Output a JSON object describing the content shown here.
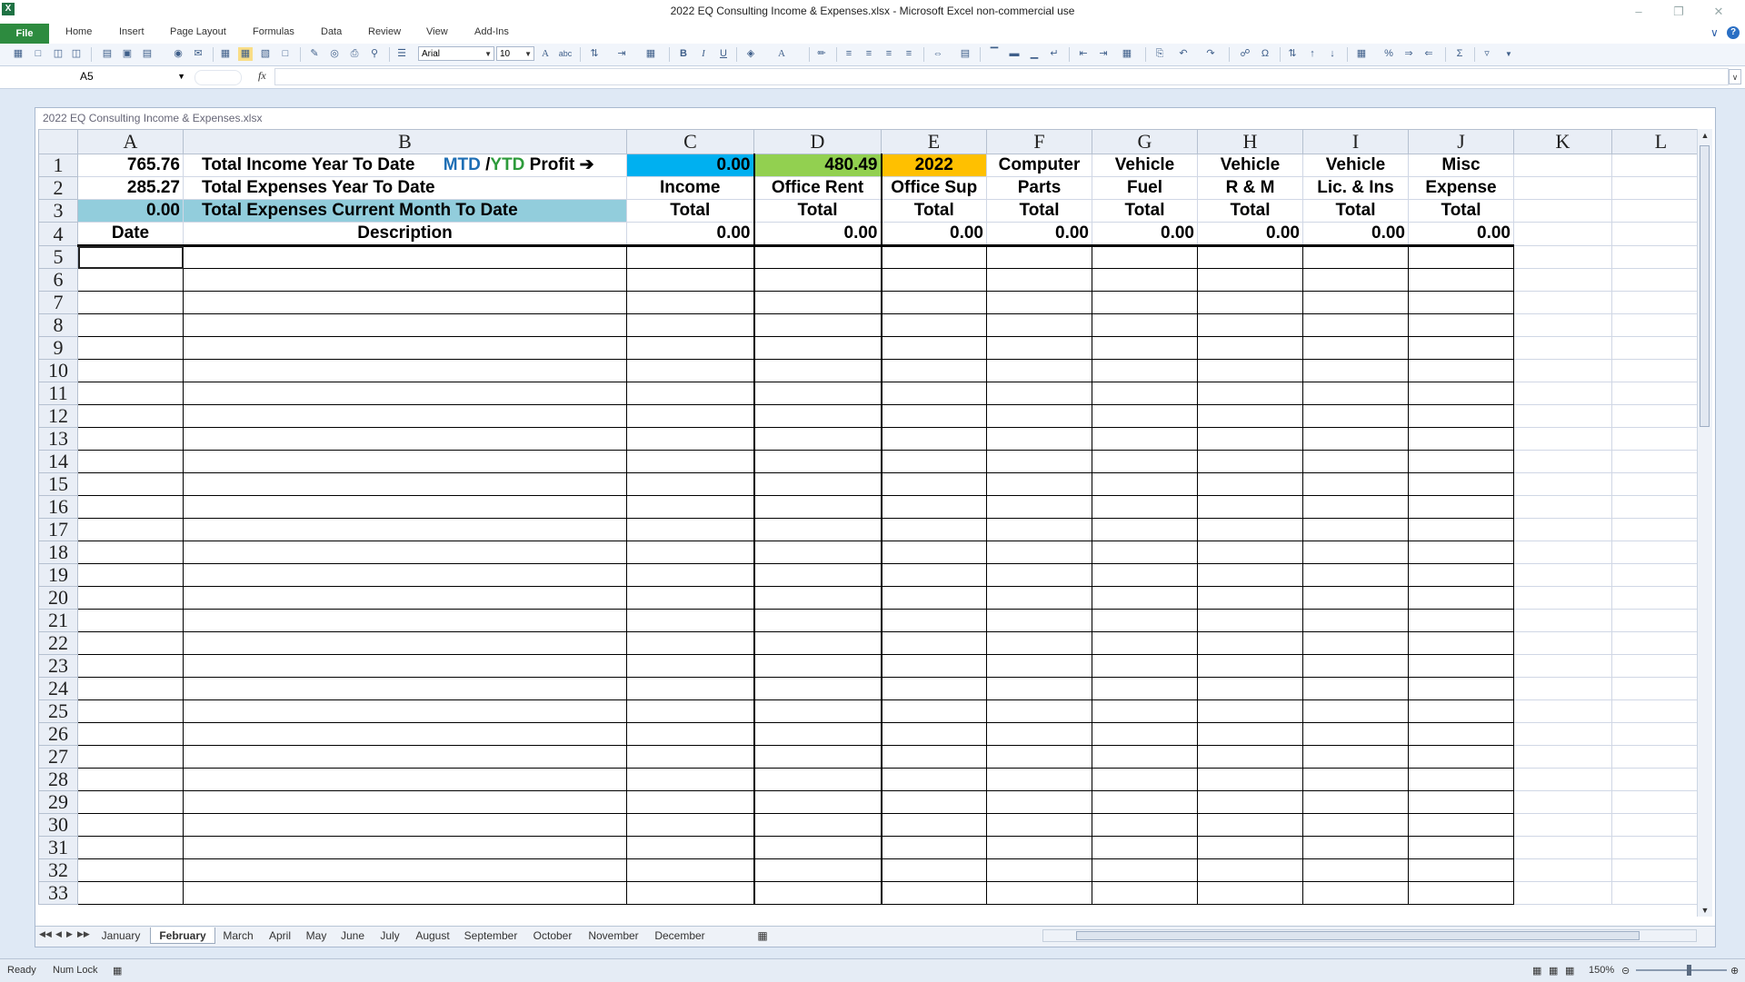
{
  "window": {
    "title": "2022 EQ Consulting Income & Expenses.xlsx  -  Microsoft Excel non-commercial use",
    "app_icon": "X"
  },
  "ribbon": {
    "file_label": "File",
    "tabs": [
      "Home",
      "Insert",
      "Page Layout",
      "Formulas",
      "Data",
      "Review",
      "View",
      "Add-Ins"
    ]
  },
  "toolbar": {
    "font": "Arial",
    "size": "10"
  },
  "formula_bar": {
    "name_box": "A5",
    "fx": "fx",
    "value": ""
  },
  "workbook": {
    "title": "2022 EQ Consulting Income & Expenses.xlsx"
  },
  "sheet": {
    "columns": [
      "A",
      "B",
      "C",
      "D",
      "E",
      "F",
      "G",
      "H",
      "I",
      "J",
      "K",
      "L"
    ],
    "r1": {
      "a": "765.76",
      "b": "Total Income Year To Date",
      "mtd": "MTD",
      "slash": " /",
      "ytd": "YTD",
      "profit": " Profit ➔",
      "c": "0.00",
      "d": "480.49",
      "e": "2022",
      "f": "Computer",
      "g": "Vehicle",
      "h": "Vehicle",
      "i": "Vehicle",
      "j": "Misc"
    },
    "r2": {
      "a": "285.27",
      "b": "Total Expenses Year To Date",
      "c": "Income",
      "d": "Office Rent",
      "e": "Office Sup",
      "f": "Parts",
      "g": "Fuel",
      "h": "R & M",
      "i": "Lic. & Ins",
      "j": "Expense"
    },
    "r3": {
      "a": "0.00",
      "b": "Total Expenses Current Month To Date",
      "c": "Total",
      "d": "Total",
      "e": "Total",
      "f": "Total",
      "g": "Total",
      "h": "Total",
      "i": "Total",
      "j": "Total"
    },
    "r4": {
      "a": "Date",
      "b": "Description",
      "c": "0.00",
      "d": "0.00",
      "e": "0.00",
      "f": "0.00",
      "g": "0.00",
      "h": "0.00",
      "i": "0.00",
      "j": "0.00"
    },
    "empty_rows": [
      "5",
      "6",
      "7",
      "8",
      "9",
      "10",
      "11",
      "12",
      "13",
      "14",
      "15",
      "16",
      "17",
      "18",
      "19",
      "20",
      "21",
      "22",
      "23",
      "24",
      "25",
      "26",
      "27",
      "28",
      "29",
      "30",
      "31",
      "32",
      "33"
    ]
  },
  "sheet_tabs": [
    "January",
    "February",
    "March",
    "April",
    "May",
    "June",
    "July",
    "August",
    "September",
    "October",
    "November",
    "December"
  ],
  "active_sheet": "February",
  "status": {
    "ready": "Ready",
    "numlock": "Num Lock",
    "zoom": "150%"
  }
}
